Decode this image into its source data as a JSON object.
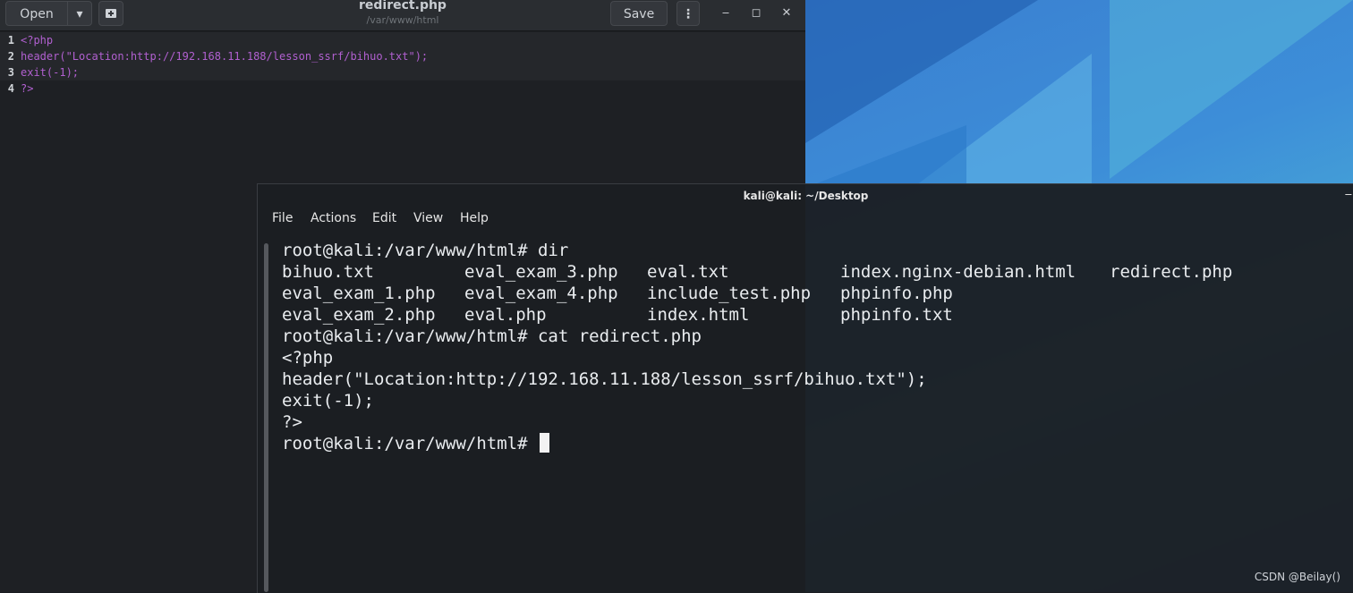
{
  "editor": {
    "open_label": "Open",
    "save_label": "Save",
    "title": "redirect.php",
    "subtitle": "/var/www/html",
    "menu_label": "⋮",
    "minimize": "‒",
    "maximize": "◻",
    "close": "✕",
    "lines": [
      {
        "num": "1",
        "text": "<?php"
      },
      {
        "num": "2",
        "text": "header(\"Location:http://192.168.11.188/lesson_ssrf/bihuo.txt\");"
      },
      {
        "num": "3",
        "text": "exit(-1);"
      },
      {
        "num": "4",
        "text": "?>"
      }
    ]
  },
  "terminal": {
    "title": "kali@kali: ~/Desktop",
    "minimize": "‒",
    "menu": [
      "File",
      "Actions",
      "Edit",
      "View",
      "Help"
    ],
    "prompt1": "root@kali:/var/www/html# dir",
    "ls_rows": [
      [
        "bihuo.txt",
        "eval_exam_3.php",
        "eval.txt",
        "index.nginx-debian.html",
        "redirect.php"
      ],
      [
        "eval_exam_1.php",
        "eval_exam_4.php",
        "include_test.php",
        "phpinfo.php",
        ""
      ],
      [
        "eval_exam_2.php",
        "eval.php",
        "index.html",
        "phpinfo.txt",
        ""
      ]
    ],
    "prompt2": "root@kali:/var/www/html# cat redirect.php",
    "cat_lines": [
      "<?php",
      "header(\"Location:http://192.168.11.188/lesson_ssrf/bihuo.txt\");",
      "exit(-1);",
      "?>"
    ],
    "prompt3": "root@kali:/var/www/html# "
  },
  "watermark": "CSDN @Beilay()",
  "colors": {
    "editor_bg": "#1e2024",
    "code_purple": "#b160d0",
    "terminal_bg": "#1b1e22",
    "desktop_blue": "#3d8ed8"
  }
}
